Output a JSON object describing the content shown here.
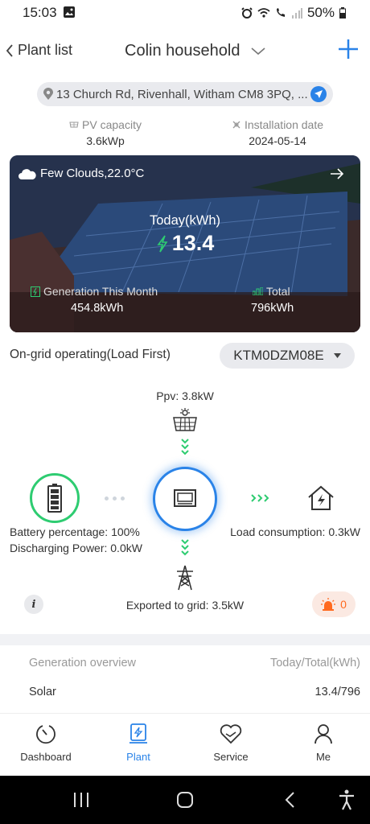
{
  "status_bar": {
    "time": "15:03",
    "battery": "50%"
  },
  "header": {
    "back_label": "Plant list",
    "plant_name": "Colin household"
  },
  "address": "13 Church Rd, Rivenhall, Witham CM8 3PQ, ...",
  "info": {
    "pv_capacity_label": "PV capacity",
    "pv_capacity_value": "3.6kWp",
    "install_label": "Installation date",
    "install_value": "2024-05-14"
  },
  "hero": {
    "weather": "Few Clouds,22.0°C",
    "today_label": "Today(kWh)",
    "today_value": "13.4",
    "month_label": "Generation This Month",
    "month_value": "454.8kWh",
    "total_label": "Total",
    "total_value": "796kWh"
  },
  "operation": {
    "mode": "On-grid operating(Load First)",
    "device": "KTM0DZM08E"
  },
  "flow": {
    "ppv": "Ppv: 3.8kW",
    "battery_percentage": "Battery percentage: 100%",
    "discharging_power": "Discharging Power: 0.0kW",
    "load": "Load consumption: 0.3kW",
    "grid": "Exported to grid: 3.5kW",
    "alarm_count": "0",
    "info_icon": "i"
  },
  "generation": {
    "title": "Generation overview",
    "unit_label": "Today/Total(kWh)",
    "rows": [
      {
        "name": "Solar",
        "value": "13.4/796"
      }
    ]
  },
  "tabs": [
    {
      "label": "Dashboard",
      "icon": "dashboard-icon"
    },
    {
      "label": "Plant",
      "icon": "plant-icon"
    },
    {
      "label": "Service",
      "icon": "service-icon"
    },
    {
      "label": "Me",
      "icon": "person-icon"
    }
  ],
  "colors": {
    "accent": "#2a83e8",
    "green": "#2ecc71",
    "alarm": "#ff6a1f"
  }
}
